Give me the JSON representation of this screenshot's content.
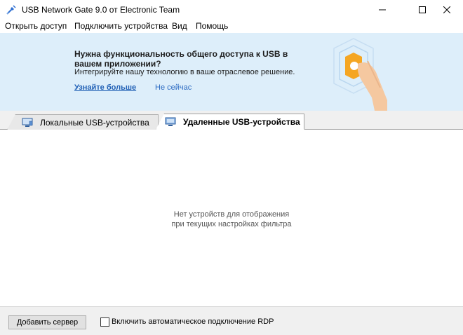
{
  "window": {
    "title": "USB Network Gate 9.0 от Electronic Team",
    "icon": "usb-plug-icon"
  },
  "menu": {
    "items": [
      {
        "label": "Открыть доступ"
      },
      {
        "label": "Подключить устройства"
      },
      {
        "label": "Вид"
      },
      {
        "label": "Помощь"
      }
    ]
  },
  "banner": {
    "title": "Нужна функциональность общего доступа к USB в вашем приложении?",
    "subtitle": "Интегрируйте нашу технологию в ваше отраслевое решение.",
    "learn_more": "Узнайте больше",
    "not_now": "Не сейчас",
    "accent_color": "#f5a623",
    "background_color": "#ddeefa"
  },
  "tabs": [
    {
      "label": "Локальные USB-устройства",
      "active": false,
      "icon": "local-computer-icon"
    },
    {
      "label": "Удаленные USB-устройства",
      "active": true,
      "icon": "remote-monitor-icon"
    }
  ],
  "content": {
    "empty_line1": "Нет устройств для отображения",
    "empty_line2": "при текущих настройках фильтра"
  },
  "bottom": {
    "add_server": "Добавить сервер",
    "rdp_label": "Включить автоматическое подключение RDP",
    "rdp_checked": false
  }
}
